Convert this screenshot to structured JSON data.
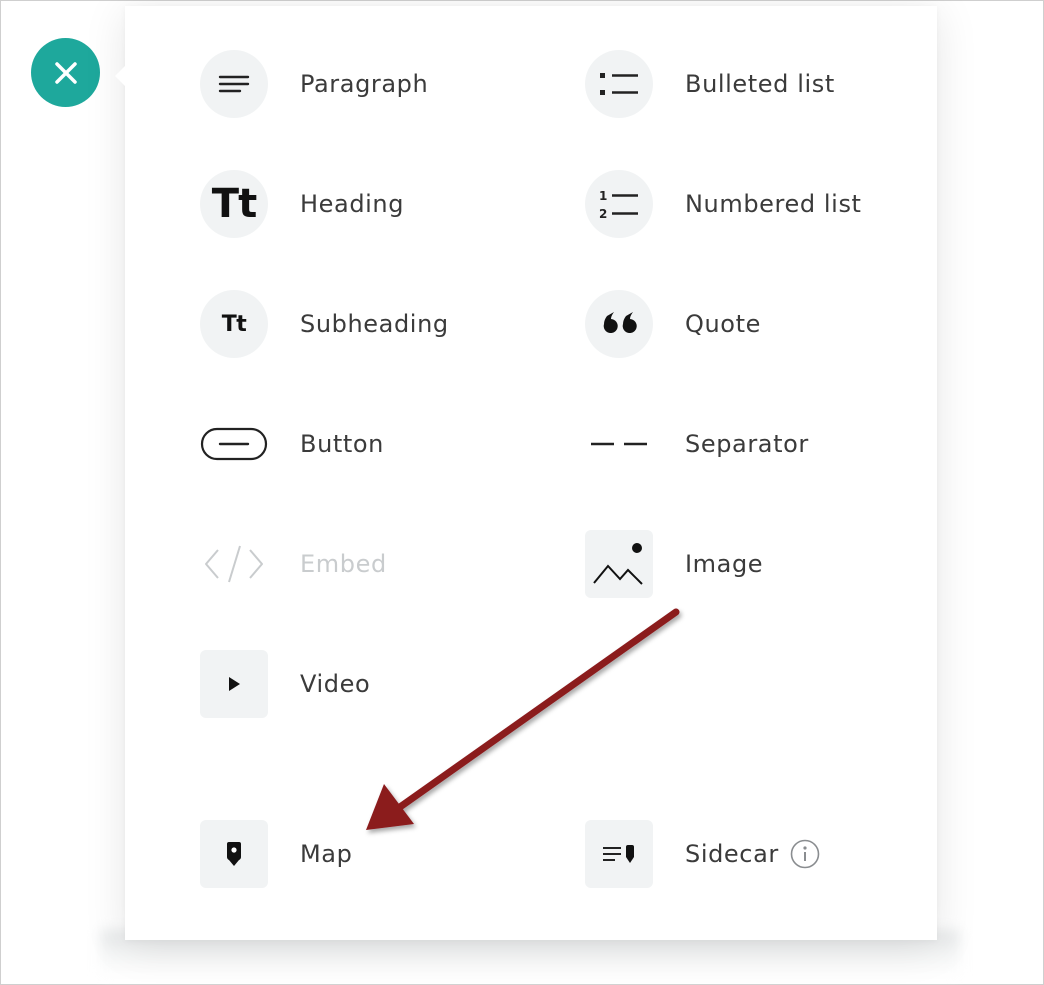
{
  "menu": {
    "left_column": [
      {
        "label": "Paragraph",
        "icon": "paragraph-icon"
      },
      {
        "label": "Heading",
        "icon": "heading-icon",
        "glyph": "Tt"
      },
      {
        "label": "Subheading",
        "icon": "subheading-icon",
        "glyph": "Tt"
      },
      {
        "label": "Button",
        "icon": "button-icon"
      },
      {
        "label": "Embed",
        "icon": "embed-icon",
        "disabled": true
      },
      {
        "label": "Video",
        "icon": "video-icon"
      },
      {
        "label": "Map",
        "icon": "map-pin-icon"
      }
    ],
    "right_column": [
      {
        "label": "Bulleted list",
        "icon": "bulleted-list-icon"
      },
      {
        "label": "Numbered list",
        "icon": "numbered-list-icon"
      },
      {
        "label": "Quote",
        "icon": "quote-icon"
      },
      {
        "label": "Separator",
        "icon": "separator-icon"
      },
      {
        "label": "Image",
        "icon": "image-icon"
      },
      {
        "label": "Sidecar",
        "icon": "sidecar-icon",
        "info_icon": "info-icon"
      }
    ]
  },
  "colors": {
    "accent": "#1ea89c",
    "arrow": "#8b1a1f",
    "label": "#3b3b3b",
    "disabled_label": "#c9ccce",
    "icon_bg": "#f1f3f4"
  },
  "close_button": {
    "icon": "close-icon"
  }
}
